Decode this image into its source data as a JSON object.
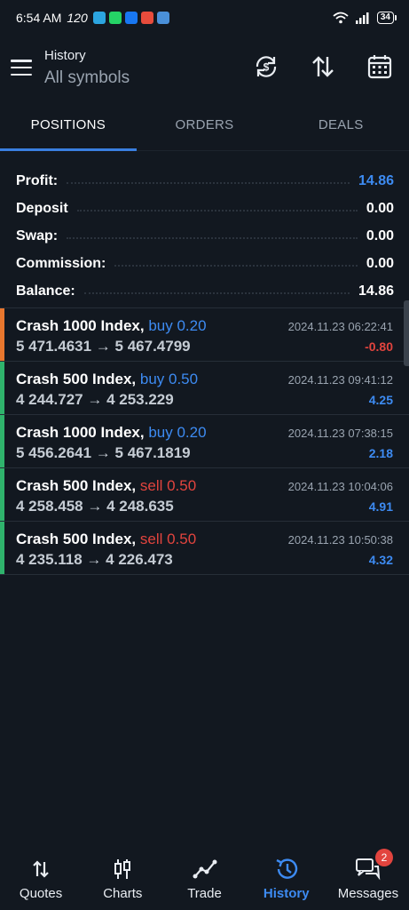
{
  "status_bar": {
    "time": "6:54 AM",
    "rate": "120",
    "battery": "34",
    "app_icons": [
      {
        "name": "telegram-icon",
        "color": "#2ca5e0"
      },
      {
        "name": "whatsapp-icon",
        "color": "#25d366"
      },
      {
        "name": "facebook-icon",
        "color": "#1877f2"
      },
      {
        "name": "app-red-icon",
        "color": "#e74c3c"
      },
      {
        "name": "gmail-icon",
        "color": "#4a90d9"
      }
    ]
  },
  "header": {
    "title": "History",
    "subtitle": "All symbols"
  },
  "tabs": [
    {
      "label": "POSITIONS",
      "active": true
    },
    {
      "label": "ORDERS",
      "active": false
    },
    {
      "label": "DEALS",
      "active": false
    }
  ],
  "summary": [
    {
      "label": "Profit:",
      "value": "14.86",
      "highlight": true
    },
    {
      "label": "Deposit",
      "value": "0.00",
      "highlight": false
    },
    {
      "label": "Swap:",
      "value": "0.00",
      "highlight": false
    },
    {
      "label": "Commission:",
      "value": "0.00",
      "highlight": false
    },
    {
      "label": "Balance:",
      "value": "14.86",
      "highlight": false
    }
  ],
  "deals": [
    {
      "symbol": "Crash 1000 Index,",
      "type": "buy 0.20",
      "side": "buy",
      "prices": "5 471.4631 → 5 467.4799",
      "time": "2024.11.23 06:22:41",
      "profit": "-0.80",
      "stripe": "#e8772e"
    },
    {
      "symbol": "Crash 500 Index,",
      "type": "buy 0.50",
      "side": "buy",
      "prices": "4 244.727 → 4 253.229",
      "time": "2024.11.23 09:41:12",
      "profit": "4.25",
      "stripe": "#2fb36c"
    },
    {
      "symbol": "Crash 1000 Index,",
      "type": "buy 0.20",
      "side": "buy",
      "prices": "5 456.2641 → 5 467.1819",
      "time": "2024.11.23 07:38:15",
      "profit": "2.18",
      "stripe": "#2fb36c"
    },
    {
      "symbol": "Crash 500 Index,",
      "type": "sell 0.50",
      "side": "sell",
      "prices": "4 258.458 → 4 248.635",
      "time": "2024.11.23 10:04:06",
      "profit": "4.91",
      "stripe": "#2fb36c"
    },
    {
      "symbol": "Crash 500 Index,",
      "type": "sell 0.50",
      "side": "sell",
      "prices": "4 235.118 → 4 226.473",
      "time": "2024.11.23 10:50:38",
      "profit": "4.32",
      "stripe": "#2fb36c"
    }
  ],
  "bottom_nav": [
    {
      "label": "Quotes",
      "icon": "quotes-icon",
      "active": false
    },
    {
      "label": "Charts",
      "icon": "charts-icon",
      "active": false
    },
    {
      "label": "Trade",
      "icon": "trade-icon",
      "active": false
    },
    {
      "label": "History",
      "icon": "history-icon",
      "active": true
    },
    {
      "label": "Messages",
      "icon": "messages-icon",
      "active": false,
      "badge": "2"
    }
  ],
  "colors": {
    "background": "#121820",
    "accent_blue": "#3d8bf2",
    "loss_red": "#e2443e",
    "profit_green": "#2fb36c",
    "loss_orange": "#e8772e"
  }
}
